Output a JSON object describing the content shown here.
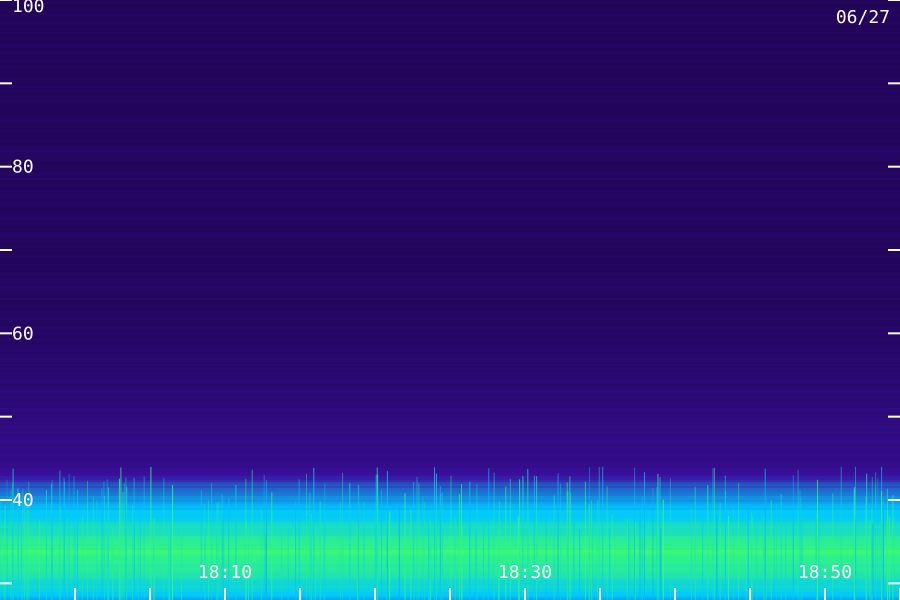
{
  "chart_data": {
    "type": "heatmap",
    "date": "06/27",
    "y_ticks": [
      {
        "value": 100,
        "label": "100"
      },
      {
        "value": 80,
        "label": "80"
      },
      {
        "value": 60,
        "label": "60"
      },
      {
        "value": 40,
        "label": "40"
      }
    ],
    "y_minor_ticks": [
      90,
      70,
      50,
      30
    ],
    "ylim": [
      28,
      100
    ],
    "x_ticks": [
      {
        "value": 10,
        "label": "18:10"
      },
      {
        "value": 30,
        "label": "18:30"
      },
      {
        "value": 50,
        "label": "18:50"
      }
    ],
    "x_minor_ticks": [
      0,
      5,
      15,
      20,
      25,
      35,
      40,
      45,
      55
    ],
    "xlim": [
      -5,
      55
    ],
    "grid": false,
    "colors": {
      "background": "#1a0040",
      "mid": "#3a10a0",
      "high": "#00c8ff",
      "peak": "#40ff60"
    },
    "intensity_profile": [
      {
        "y": 100,
        "level": 0.1
      },
      {
        "y": 60,
        "level": 0.13
      },
      {
        "y": 44,
        "level": 0.28
      },
      {
        "y": 41,
        "level": 0.55
      },
      {
        "y": 37,
        "level": 0.8
      },
      {
        "y": 34,
        "level": 0.95
      },
      {
        "y": 31,
        "level": 0.85
      },
      {
        "y": 28,
        "level": 0.65
      }
    ]
  }
}
